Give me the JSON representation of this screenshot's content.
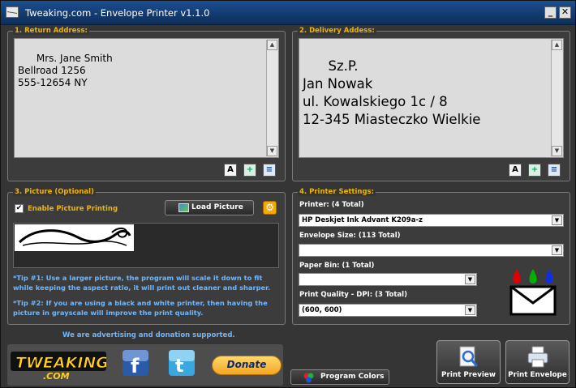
{
  "window": {
    "title": "Tweaking.com - Envelope Printer v1.1.0",
    "min_label": "_",
    "close_label": "✕"
  },
  "return_address": {
    "title": "1. Return Address:",
    "text": "Mrs. Jane Smith\nBellroad 1256\n555-12654 NY"
  },
  "delivery_address": {
    "title": "2. Delivery Addess:",
    "text": "Sz.P.\nJan Nowak\nul. Kowalskiego 1c / 8\n12-345 Miasteczko Wielkie"
  },
  "picture": {
    "title": "3. Picture (Optional)",
    "enable_label": "Enable Picture Printing",
    "enable_checked": true,
    "load_label": "Load Picture",
    "tip1": "*Tip #1: Use a larger picture, the program will scale it down to fit while keeping the aspect ratio, it will print out cleaner and sharper.",
    "tip2": "*Tip #2: If you are using a black and white printer, then having the picture in grayscale will improve the print quality."
  },
  "printer": {
    "title": "4. Printer Settings:",
    "printer_label": "Printer: (4 Total)",
    "printer_value": "HP Deskjet Ink Advant K209a-z",
    "size_label": "Envelope Size: (113 Total)",
    "size_value": "",
    "bin_label": "Paper Bin: (1 Total)",
    "bin_value": "",
    "dpi_label": "Print Quality - DPI: (3 Total)",
    "dpi_value": "(600, 600)"
  },
  "footer": {
    "support_text": "We are advertising and donation supported.",
    "logo_text": "TWEAKING",
    "logo_sub": ".COM",
    "donate_label": "Donate",
    "colors_label": "Program Colors",
    "preview_label": "Print Preview",
    "print_label": "Print Envelope"
  },
  "colors": {
    "accent": "#f0b400",
    "tip": "#6fb7ff",
    "title_bar": "#1d4f91"
  }
}
